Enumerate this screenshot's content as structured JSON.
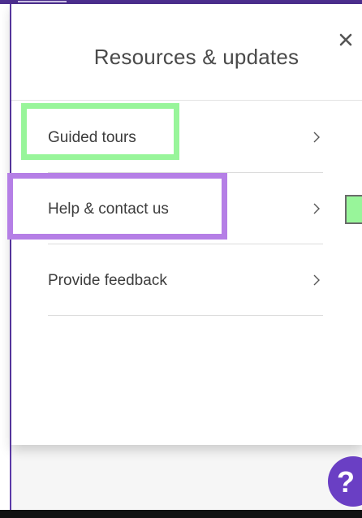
{
  "panel": {
    "title": "Resources & updates",
    "close_icon": "close-icon"
  },
  "menu": {
    "items": [
      {
        "label": "Guided tours",
        "icon": "chevron-right-icon"
      },
      {
        "label": "Help & contact us",
        "icon": "chevron-right-icon"
      },
      {
        "label": "Provide feedback",
        "icon": "chevron-right-icon"
      }
    ]
  },
  "help_button": {
    "glyph": "?",
    "icon": "question-mark-icon"
  },
  "colors": {
    "brand_purple": "#5c3aa8",
    "help_button": "#6a3fc4",
    "highlight_green": "#98f59a",
    "highlight_purple": "#b57fe6",
    "text": "#3c3c3c"
  }
}
